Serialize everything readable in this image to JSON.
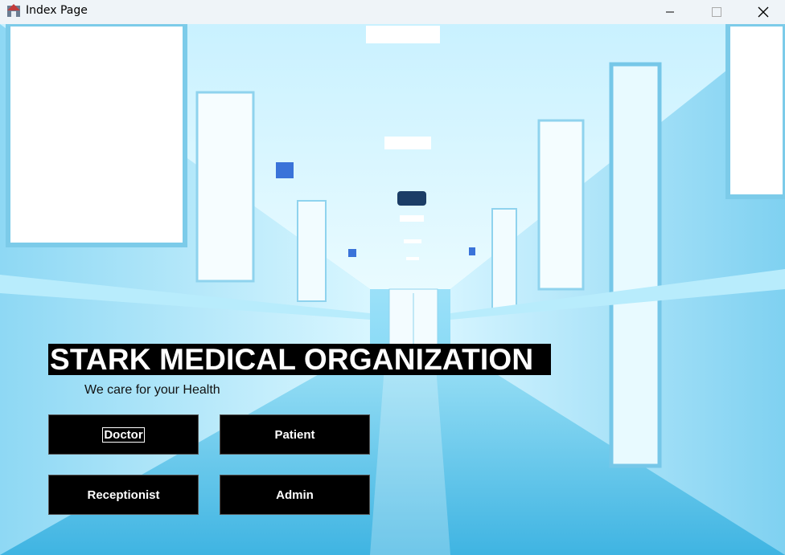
{
  "window": {
    "title": "Index Page",
    "icon": "java-app-icon",
    "controls": [
      "minimize-icon",
      "maximize-icon",
      "close-icon"
    ]
  },
  "main": {
    "heading": "STARK MEDICAL ORGANIZATION",
    "tagline": "We care for your Health",
    "background": "hospital-corridor-image",
    "buttons": {
      "doctor": "Doctor",
      "patient": "Patient",
      "receptionist": "Receptionist",
      "admin": "Admin"
    }
  },
  "colors": {
    "button_bg": "#000000",
    "button_text": "#ffffff",
    "scene_accent": "#5fc9ef"
  }
}
